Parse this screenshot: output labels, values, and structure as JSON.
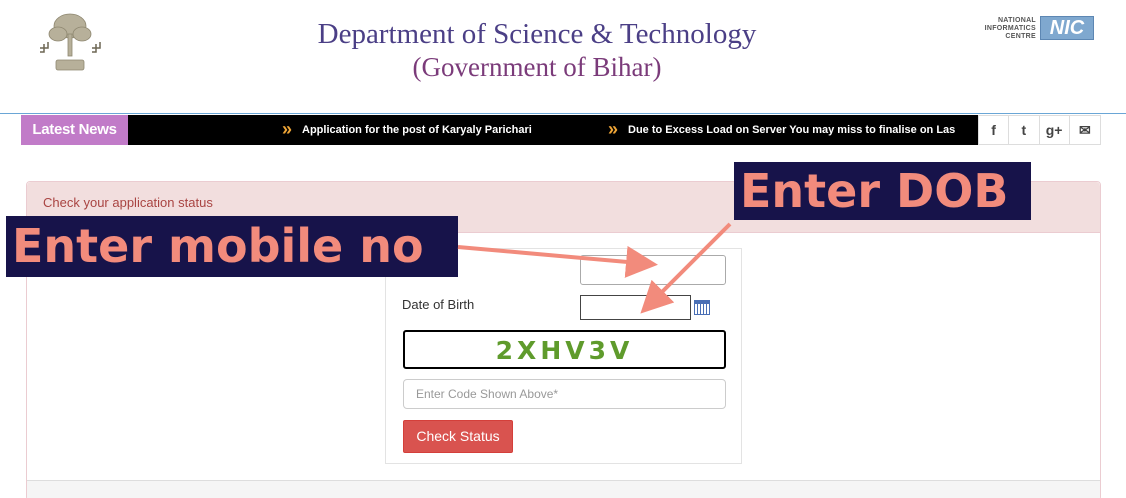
{
  "header": {
    "title_line1": "Department of Science & Technology",
    "title_line2": "(Government of Bihar)",
    "nic_small": "NATIONAL INFORMATICS CENTRE",
    "nic_logo": "NIC"
  },
  "news": {
    "label": "Latest News",
    "items": [
      "Application for the post of Karyaly Parichari",
      "Due to Excess Load on Server You may miss to finalise on Las"
    ],
    "bullet_icon": "chevron-double-icon",
    "social_icons": [
      "facebook-icon",
      "twitter-icon",
      "google-plus-icon",
      "mail-icon"
    ],
    "social_glyphs": [
      "f",
      "t",
      "g+",
      "✉"
    ]
  },
  "panel": {
    "heading": "Check your application status"
  },
  "form": {
    "mobile_value": "",
    "dob_label": "Date of Birth",
    "dob_value": "",
    "captcha": "2XHV3V",
    "code_placeholder": "Enter Code Shown Above*",
    "submit_label": "Check Status"
  },
  "annotations": {
    "mobile": "Enter mobile no",
    "dob": "Enter DOB"
  },
  "colors": {
    "annotation_bg": "#17134a",
    "annotation_text": "#f28b7c",
    "panel_heading_bg": "#f2dede",
    "button_bg": "#d9534f",
    "news_label_bg": "#c17bc8"
  }
}
